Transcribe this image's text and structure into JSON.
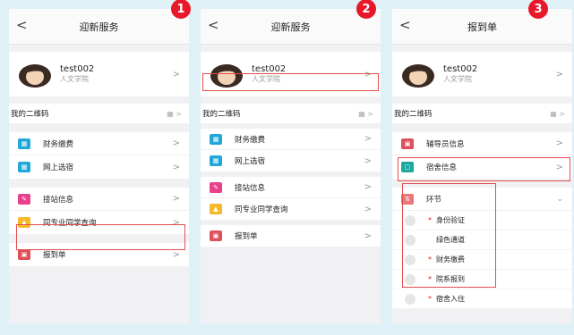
{
  "screens": [
    {
      "step": "1",
      "title": "迎新服务",
      "back": "<",
      "user": {
        "name": "test002",
        "dept": "人文学院"
      },
      "qr_label": "我的二维码",
      "qr_icon": "▦ >",
      "groups": [
        [
          {
            "label": "财务缴费",
            "icon": "grid-icon",
            "color": "#22a8d8"
          },
          {
            "label": "网上选宿",
            "icon": "grid-icon",
            "color": "#22a8d8"
          }
        ],
        [
          {
            "label": "接站信息",
            "icon": "pencil-icon",
            "color": "#e8408a"
          },
          {
            "label": "同专业同学查询",
            "icon": "graduation-cap-icon",
            "color": "#f5b92c"
          }
        ],
        [
          {
            "label": "报到单",
            "icon": "id-card-icon",
            "color": "#e0505a"
          }
        ]
      ]
    },
    {
      "step": "2",
      "title": "迎新服务",
      "back": "<",
      "user": {
        "name": "test002",
        "dept": "人文学院"
      },
      "qr_label": "我的二维码",
      "qr_icon": "▦ >",
      "groups": [
        [
          {
            "label": "财务缴费",
            "icon": "grid-icon",
            "color": "#22a8d8"
          },
          {
            "label": "网上选宿",
            "icon": "grid-icon",
            "color": "#22a8d8"
          }
        ],
        [
          {
            "label": "接站信息",
            "icon": "pencil-icon",
            "color": "#e8408a"
          },
          {
            "label": "同专业同学查询",
            "icon": "graduation-cap-icon",
            "color": "#f5b92c"
          }
        ],
        [
          {
            "label": "报到单",
            "icon": "id-card-icon",
            "color": "#e0505a"
          }
        ]
      ]
    },
    {
      "step": "3",
      "title": "报到单",
      "back": "<",
      "user": {
        "name": "test002",
        "dept": "人文学院"
      },
      "qr_label": "我的二维码",
      "qr_icon": "▦ >",
      "info": [
        {
          "label": "辅导员信息",
          "icon": "id-card-icon",
          "color": "#e0505a"
        },
        {
          "label": "宿舍信息",
          "icon": "dorm-icon",
          "color": "#1aa9a0"
        }
      ],
      "section": {
        "label": "环节",
        "icon": "flow-icon",
        "color": "#e9767a"
      },
      "stages": [
        {
          "label": "身份验证",
          "required": "*"
        },
        {
          "label": "绿色通道",
          "required": ""
        },
        {
          "label": "财务缴费",
          "required": "*"
        },
        {
          "label": "院系报到",
          "required": "*"
        },
        {
          "label": "宿舍入住",
          "required": "*"
        }
      ]
    }
  ],
  "highlight_color": "#e54d4d"
}
